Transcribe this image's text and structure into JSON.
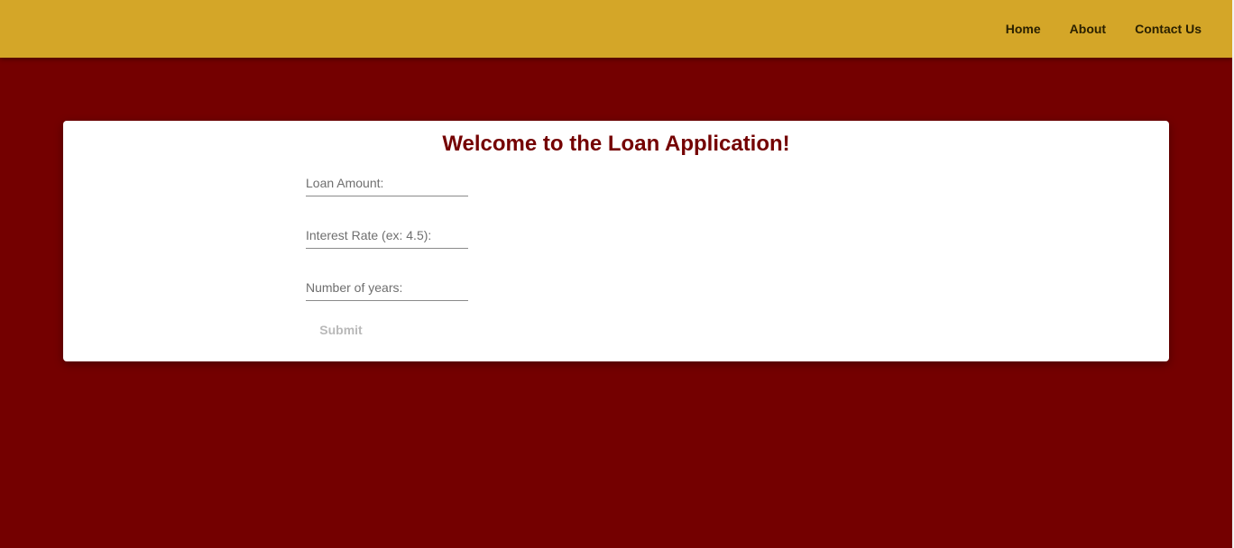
{
  "nav": {
    "items": [
      {
        "label": "Home"
      },
      {
        "label": "About"
      },
      {
        "label": "Contact Us"
      }
    ]
  },
  "card": {
    "title": "Welcome to the Loan Application!",
    "fields": [
      {
        "placeholder": "Loan Amount:",
        "value": ""
      },
      {
        "placeholder": "Interest Rate (ex: 4.5):",
        "value": ""
      },
      {
        "placeholder": "Number of years:",
        "value": ""
      }
    ],
    "submit_label": "Submit"
  },
  "colors": {
    "header": "#d4a628",
    "background": "#740000",
    "title": "#740000"
  }
}
